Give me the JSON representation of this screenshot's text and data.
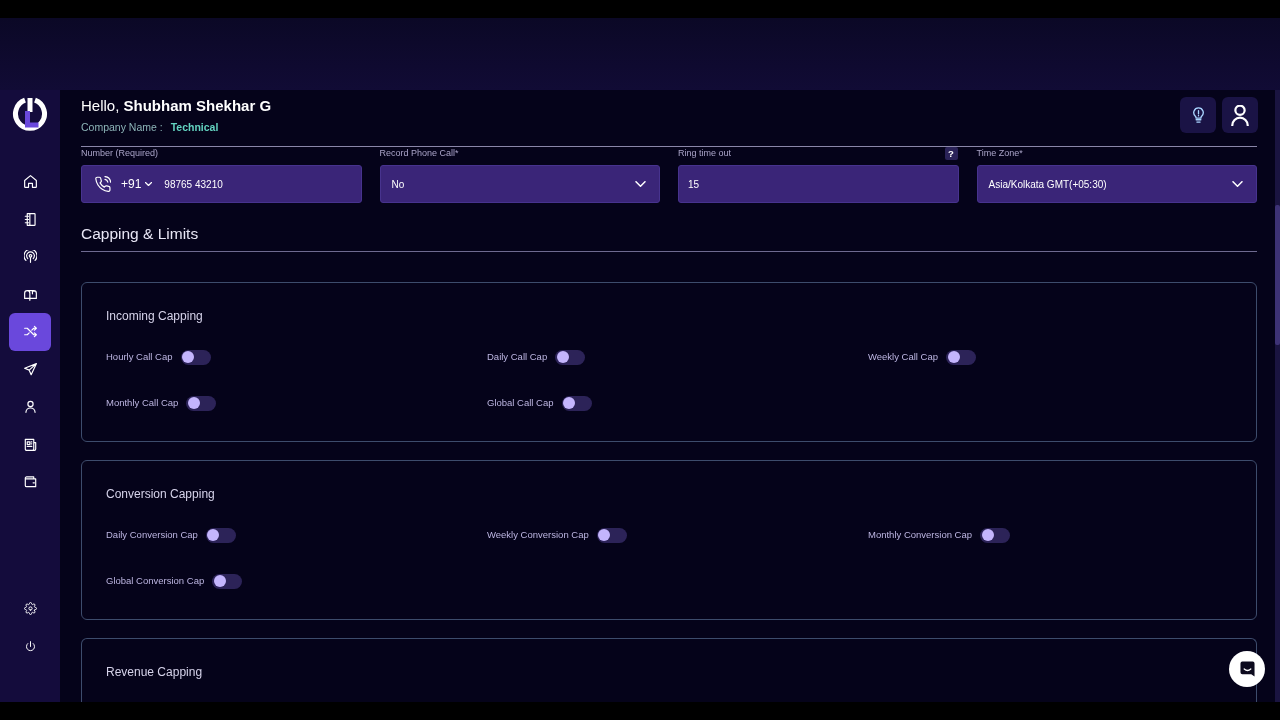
{
  "greeting": "Hello, **Shubham Shekhar G**",
  "company": {
    "label": "Company Name :",
    "value": "Technical"
  },
  "sidebar": {
    "items": [
      {
        "selected": false
      },
      {
        "selected": false
      },
      {
        "selected": false
      },
      {
        "selected": false
      },
      {
        "selected": true
      },
      {
        "selected": false
      },
      {
        "selected": false
      },
      {
        "selected": false
      },
      {
        "selected": false
      }
    ],
    "bottom_items": [
      {
        "selected": false
      },
      {
        "selected": false
      }
    ]
  },
  "fields": [
    {
      "kind": "phone",
      "label": "Number (Required)",
      "code": "+91",
      "value": "98765 43210"
    },
    {
      "kind": "select",
      "label": "Record Phone Call*",
      "value": "No"
    },
    {
      "kind": "input",
      "label": "Ring time out",
      "value": "15",
      "help": "?"
    },
    {
      "kind": "select",
      "label": "Time Zone*",
      "value": "Asia/Kolkata GMT(+05:30)"
    }
  ],
  "section_title": "Capping & Limits",
  "cards": [
    {
      "title": "Incoming Capping",
      "toggles": [
        {
          "label": "Hourly Call Cap",
          "on": false
        },
        {
          "label": "Daily Call Cap",
          "on": false
        },
        {
          "label": "Weekly Call Cap",
          "on": false
        },
        {
          "label": "Monthly Call Cap",
          "on": false
        },
        {
          "label": "Global Call Cap",
          "on": false
        }
      ]
    },
    {
      "title": "Conversion Capping",
      "toggles": [
        {
          "label": "Daily Conversion Cap",
          "on": false
        },
        {
          "label": "Weekly Conversion Cap",
          "on": false
        },
        {
          "label": "Monthly Conversion Cap",
          "on": false
        },
        {
          "label": "Global Conversion Cap",
          "on": false
        }
      ]
    },
    {
      "title": "Revenue Capping"
    }
  ]
}
